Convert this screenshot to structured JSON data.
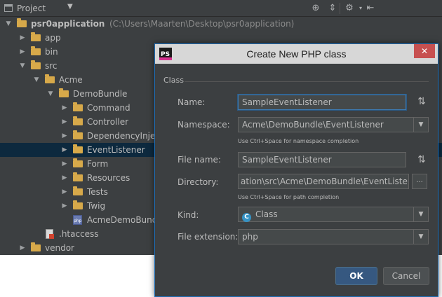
{
  "project_panel": {
    "title": "Project",
    "tree": [
      {
        "label": "psr0application",
        "path": "(C:\\Users\\Maarten\\Desktop\\psr0application)",
        "level": 0,
        "expanded": true,
        "icon": "folder-icon"
      },
      {
        "label": "app",
        "level": 1,
        "expanded": false,
        "icon": "folder-icon"
      },
      {
        "label": "bin",
        "level": 1,
        "expanded": false,
        "icon": "folder-icon"
      },
      {
        "label": "src",
        "level": 1,
        "expanded": true,
        "icon": "folder-icon"
      },
      {
        "label": "Acme",
        "level": 2,
        "expanded": true,
        "icon": "folder-icon"
      },
      {
        "label": "DemoBundle",
        "level": 3,
        "expanded": true,
        "icon": "folder-icon"
      },
      {
        "label": "Command",
        "level": 4,
        "expanded": false,
        "icon": "folder-icon"
      },
      {
        "label": "Controller",
        "level": 4,
        "expanded": false,
        "icon": "folder-icon"
      },
      {
        "label": "DependencyInjec",
        "level": 4,
        "expanded": false,
        "icon": "folder-icon"
      },
      {
        "label": "EventListener",
        "level": 4,
        "expanded": false,
        "icon": "folder-icon",
        "selected": true
      },
      {
        "label": "Form",
        "level": 4,
        "expanded": false,
        "icon": "folder-icon"
      },
      {
        "label": "Resources",
        "level": 4,
        "expanded": false,
        "icon": "folder-icon"
      },
      {
        "label": "Tests",
        "level": 4,
        "expanded": false,
        "icon": "folder-icon"
      },
      {
        "label": "Twig",
        "level": 4,
        "expanded": false,
        "icon": "folder-icon"
      },
      {
        "label": "AcmeDemoBund",
        "level": 4,
        "icon": "php-file-icon"
      },
      {
        "label": ".htaccess",
        "level": 2,
        "icon": "htaccess-file-icon"
      },
      {
        "label": "vendor",
        "level": 1,
        "expanded": false,
        "icon": "folder-icon"
      }
    ]
  },
  "dialog": {
    "title": "Create New PHP class",
    "close_label": "✕",
    "section_label": "Class",
    "name": {
      "label": "Name:",
      "value": "SampleEventListener"
    },
    "namespace": {
      "label": "Namespace:",
      "value": "Acme\\DemoBundle\\EventListener",
      "hint": "Use Ctrl+Space for namespace completion"
    },
    "file_name": {
      "label": "File name:",
      "value": "SampleEventListener"
    },
    "directory": {
      "label": "Directory:",
      "value": "ation\\src\\Acme\\DemoBundle\\EventListener",
      "hint": "Use Ctrl+Space for path completion",
      "browse_label": "..."
    },
    "kind": {
      "label": "Kind:",
      "value": "Class",
      "icon_letter": "C"
    },
    "file_extension": {
      "label": "File extension:",
      "value": "php"
    },
    "ok_label": "OK",
    "cancel_label": "Cancel"
  },
  "colors": {
    "accent": "#365880",
    "selection": "#0d293e",
    "folder": "#d7a94a",
    "close": "#c75050"
  }
}
